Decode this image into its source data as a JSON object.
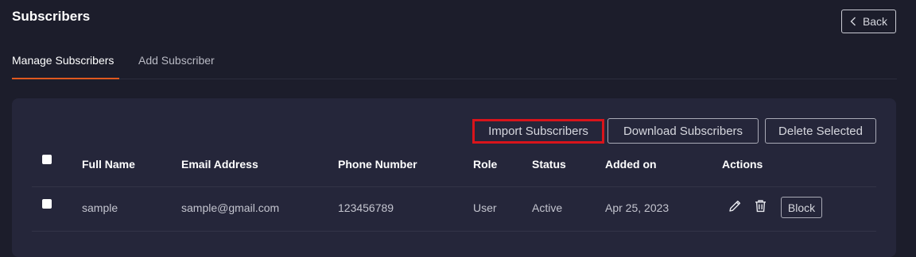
{
  "header": {
    "title": "Subscribers",
    "back_label": "Back"
  },
  "tabs": [
    {
      "label": "Manage Subscribers",
      "active": true
    },
    {
      "label": "Add Subscriber",
      "active": false
    }
  ],
  "toolbar": {
    "import_label": "Import Subscribers",
    "download_label": "Download Subscribers",
    "delete_label": "Delete Selected"
  },
  "table": {
    "columns": [
      "Full Name",
      "Email Address",
      "Phone Number",
      "Role",
      "Status",
      "Added on",
      "Actions"
    ],
    "rows": [
      {
        "full_name": "sample",
        "email": "sample@gmail.com",
        "phone": "123456789",
        "role": "User",
        "status": "Active",
        "added_on": "Apr 25, 2023",
        "block_label": "Block"
      }
    ]
  },
  "colors": {
    "background": "#1c1d2b",
    "card": "#25263a",
    "accent": "#e0581f",
    "highlight": "#d9141b"
  },
  "icons": [
    "chevron-left-icon",
    "pencil-icon",
    "trash-icon"
  ]
}
